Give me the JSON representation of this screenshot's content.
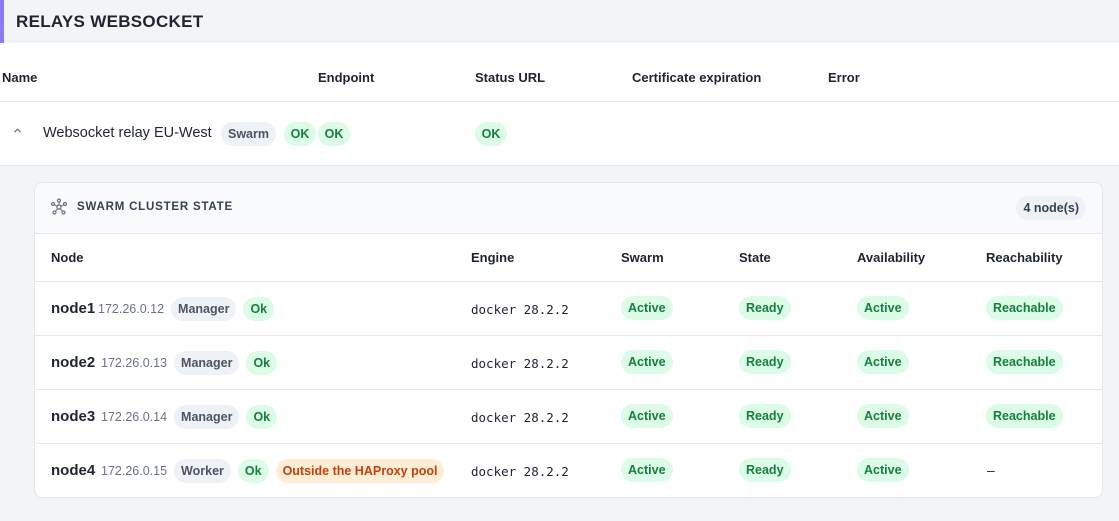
{
  "section": {
    "title": "RELAYS WEBSOCKET"
  },
  "relay_table": {
    "columns": [
      "Name",
      "Endpoint",
      "Status URL",
      "Certificate expiration",
      "Error"
    ],
    "rows": [
      {
        "name": "Websocket relay EU-West",
        "badges": [
          "Swarm",
          "OK",
          "OK"
        ],
        "status_url": "OK",
        "certificate_expiration": "",
        "error": ""
      }
    ]
  },
  "swarm": {
    "title": "SWARM CLUSTER STATE",
    "node_count": "4 node(s)",
    "columns": [
      "Node",
      "Engine",
      "Swarm",
      "State",
      "Availability",
      "Reachability"
    ],
    "nodes": [
      {
        "name": "node1",
        "ip": "172.26.0.12",
        "role": "Manager",
        "health": "Ok",
        "note": "",
        "engine": "docker 28.2.2",
        "swarm": "Active",
        "state": "Ready",
        "availability": "Active",
        "reachability": "Reachable"
      },
      {
        "name": "node2",
        "ip": "172.26.0.13",
        "role": "Manager",
        "health": "Ok",
        "note": "",
        "engine": "docker 28.2.2",
        "swarm": "Active",
        "state": "Ready",
        "availability": "Active",
        "reachability": "Reachable"
      },
      {
        "name": "node3",
        "ip": "172.26.0.14",
        "role": "Manager",
        "health": "Ok",
        "note": "",
        "engine": "docker 28.2.2",
        "swarm": "Active",
        "state": "Ready",
        "availability": "Active",
        "reachability": "Reachable"
      },
      {
        "name": "node4",
        "ip": "172.26.0.15",
        "role": "Worker",
        "health": "Ok",
        "note": "Outside the HAProxy pool",
        "engine": "docker 28.2.2",
        "swarm": "Active",
        "state": "Ready",
        "availability": "Active",
        "reachability": "–"
      }
    ]
  },
  "icons": {
    "collapse": "chevron-up-icon",
    "swarm": "cluster-icon"
  },
  "colors": {
    "accent": "#8b7cf6",
    "ok_bg": "#dcfce7",
    "ok_text": "#15803d",
    "warn_bg": "#ffedd5",
    "warn_text": "#c2410c"
  }
}
